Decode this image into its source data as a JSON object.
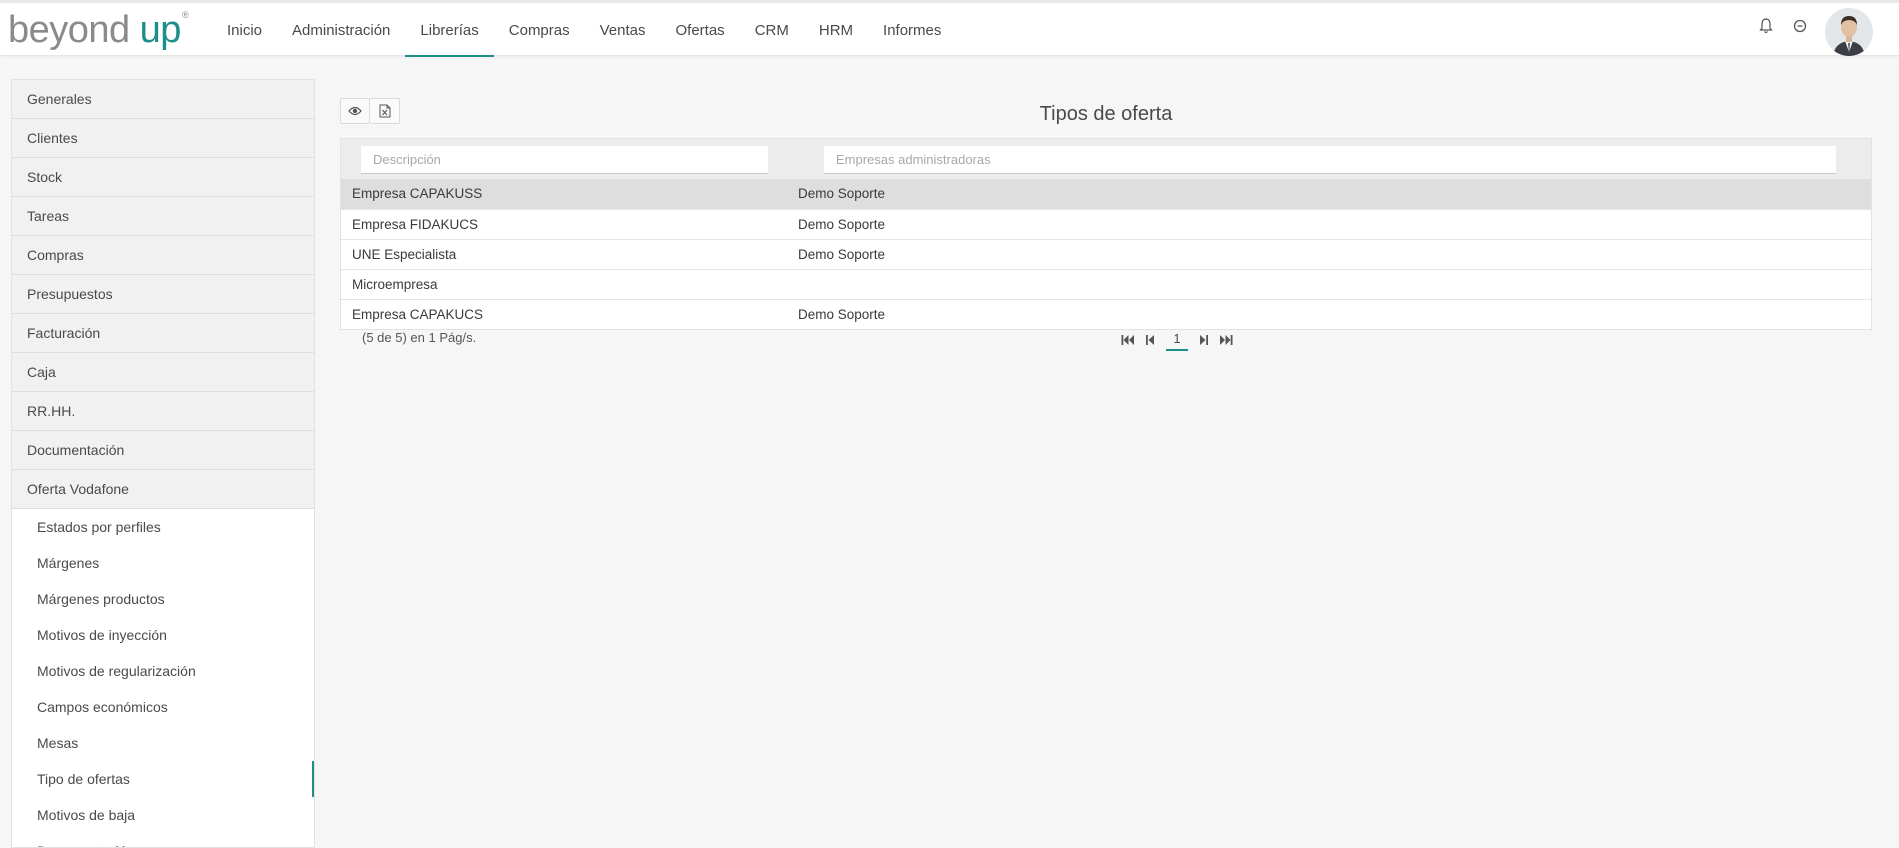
{
  "brand": {
    "word1": "beyond",
    "word2": "up",
    "reg": "®",
    "accent": "#1c8f8a"
  },
  "nav": {
    "items": [
      {
        "label": "Inicio",
        "active": false
      },
      {
        "label": "Administración",
        "active": false
      },
      {
        "label": "Librerías",
        "active": true
      },
      {
        "label": "Compras",
        "active": false
      },
      {
        "label": "Ventas",
        "active": false
      },
      {
        "label": "Ofertas",
        "active": false
      },
      {
        "label": "CRM",
        "active": false
      },
      {
        "label": "HRM",
        "active": false
      },
      {
        "label": "Informes",
        "active": false
      }
    ]
  },
  "header_icons": [
    "bell-icon",
    "power-icon",
    "user-avatar"
  ],
  "sidebar": {
    "sections": [
      "Generales",
      "Clientes",
      "Stock",
      "Tareas",
      "Compras",
      "Presupuestos",
      "Facturación",
      "Caja",
      "RR.HH.",
      "Documentación",
      "Oferta Vodafone"
    ],
    "subitems": [
      {
        "label": "Estados por perfiles",
        "active": false
      },
      {
        "label": "Márgenes",
        "active": false
      },
      {
        "label": "Márgenes productos",
        "active": false
      },
      {
        "label": "Motivos de inyección",
        "active": false
      },
      {
        "label": "Motivos de regularización",
        "active": false
      },
      {
        "label": "Campos económicos",
        "active": false
      },
      {
        "label": "Mesas",
        "active": false
      },
      {
        "label": "Tipo de ofertas",
        "active": true
      },
      {
        "label": "Motivos de baja",
        "active": false
      },
      {
        "label": "Documentación",
        "active": false
      }
    ]
  },
  "main": {
    "title": "Tipos de oferta",
    "toolbar_icons": [
      "eye-icon",
      "excel-export-icon"
    ],
    "filters": {
      "descripcion_placeholder": "Descripción",
      "empresas_placeholder": "Empresas administradoras"
    },
    "rows": [
      {
        "descripcion": "Empresa CAPAKUSS",
        "empresa": "Demo Soporte",
        "selected": true
      },
      {
        "descripcion": "Empresa FIDAKUCS",
        "empresa": "Demo Soporte",
        "selected": false
      },
      {
        "descripcion": "UNE Especialista",
        "empresa": "Demo Soporte",
        "selected": false
      },
      {
        "descripcion": "Microempresa",
        "empresa": "",
        "selected": false
      },
      {
        "descripcion": "Empresa CAPAKUCS",
        "empresa": "Demo Soporte",
        "selected": false
      }
    ],
    "paging": {
      "info": "(5 de 5) en 1 Pág/s.",
      "current_page": "1"
    }
  }
}
